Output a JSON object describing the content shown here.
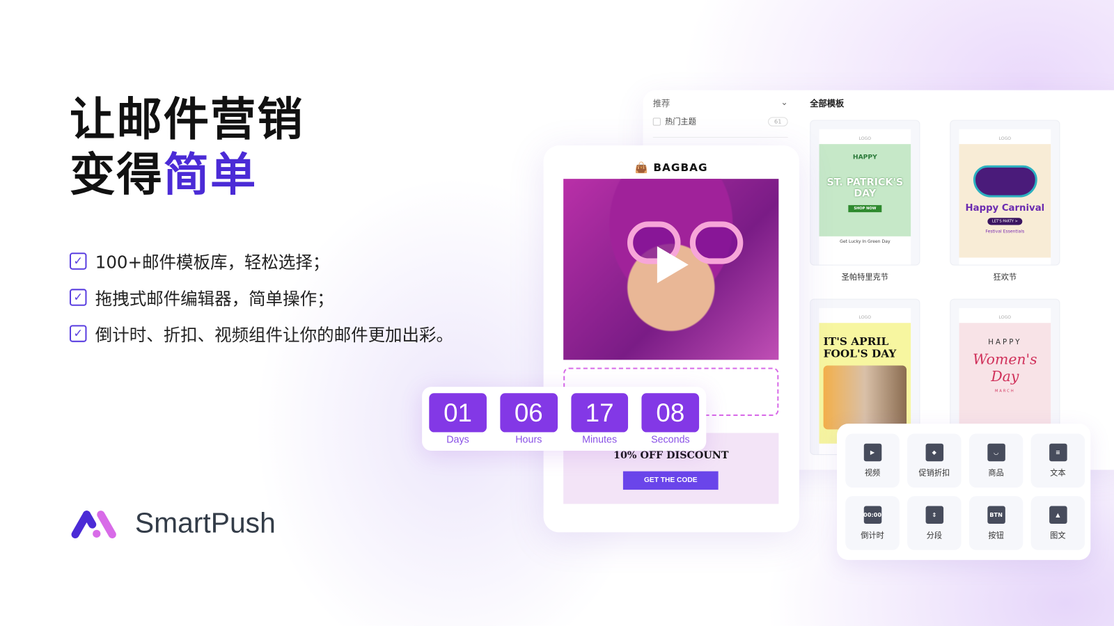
{
  "headline": {
    "line1": "让邮件营销",
    "line2_prefix": "变得",
    "line2_highlight": "简单"
  },
  "features": [
    "100+邮件模板库，轻松选择；",
    "拖拽式邮件编辑器，简单操作；",
    "倒计时、折扣、视频组件让你的邮件更加出彩。"
  ],
  "brand": {
    "name": "SmartPush",
    "colors": {
      "primary": "#4b2bd6",
      "secondary": "#d86be8"
    }
  },
  "template_panel": {
    "filter_label": "推荐",
    "filter_item": "热门主题",
    "filter_count": "61",
    "all_templates": "全部模板",
    "templates": [
      {
        "name": "圣帕特里克节",
        "headline": "ST. PATRICK'S DAY",
        "kicker": "HAPPY",
        "cta": "SHOP NOW",
        "footer": "Get Lucky In Green Day",
        "bg": "#c6e8c8"
      },
      {
        "name": "狂欢节",
        "headline": "Happy Carnival",
        "cta": "LET'S PARTY >",
        "footer": "Festival Essentials",
        "bg": "#f8ecd6"
      },
      {
        "name": "",
        "headline": "IT'S APRIL FOOL'S DAY",
        "bg": "#f7f6a0"
      },
      {
        "name": "",
        "headline": "Women's Day",
        "kicker": "HAPPY",
        "sub": "MARCH",
        "bg": "#f8e3e7"
      }
    ],
    "logo_text": "LOGO"
  },
  "editor": {
    "brand": "BAGBAG",
    "discount": "10% OFF DISCOUNT",
    "cta": "GET THE CODE",
    "accent": "#6a45ea"
  },
  "countdown": [
    {
      "value": "01",
      "label": "Days"
    },
    {
      "value": "06",
      "label": "Hours"
    },
    {
      "value": "17",
      "label": "Minutes"
    },
    {
      "value": "08",
      "label": "Seconds"
    }
  ],
  "components": [
    {
      "label": "视频",
      "icon": "video-icon",
      "glyph": "▶"
    },
    {
      "label": "促销折扣",
      "icon": "tag-icon",
      "glyph": "◆"
    },
    {
      "label": "商品",
      "icon": "shopping-bag-icon",
      "glyph": "◡"
    },
    {
      "label": "文本",
      "icon": "text-icon",
      "glyph": "≡"
    },
    {
      "label": "倒计时",
      "icon": "countdown-icon",
      "glyph": "00:00"
    },
    {
      "label": "分段",
      "icon": "divider-icon",
      "glyph": "⇕"
    },
    {
      "label": "按钮",
      "icon": "button-icon",
      "glyph": "BTN"
    },
    {
      "label": "图文",
      "icon": "image-text-icon",
      "glyph": "▲"
    }
  ]
}
